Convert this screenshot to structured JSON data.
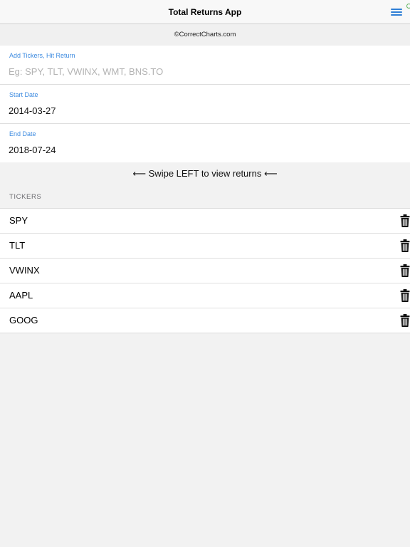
{
  "nav": {
    "title": "Total Returns App",
    "menu_icon": "hamburger-menu-icon",
    "accent_color": "#2f7fd6"
  },
  "credit": "©CorrectCharts.com",
  "form": {
    "tickers": {
      "label": "Add Tickers, Hit Return",
      "value": "",
      "placeholder": "Eg: SPY, TLT, VWINX, WMT, BNS.TO"
    },
    "start_date": {
      "label": "Start Date",
      "value": "2014-03-27"
    },
    "end_date": {
      "label": "End Date",
      "value": "2018-07-24"
    },
    "label_color": "#3d8be0"
  },
  "swipe_hint": "⟵ Swipe LEFT to view returns ⟵",
  "tickers_section": {
    "header": "TICKERS",
    "items": [
      {
        "symbol": "SPY",
        "delete_icon": "trash-icon"
      },
      {
        "symbol": "TLT",
        "delete_icon": "trash-icon"
      },
      {
        "symbol": "VWINX",
        "delete_icon": "trash-icon"
      },
      {
        "symbol": "AAPL",
        "delete_icon": "trash-icon"
      },
      {
        "symbol": "GOOG",
        "delete_icon": "trash-icon"
      }
    ]
  }
}
